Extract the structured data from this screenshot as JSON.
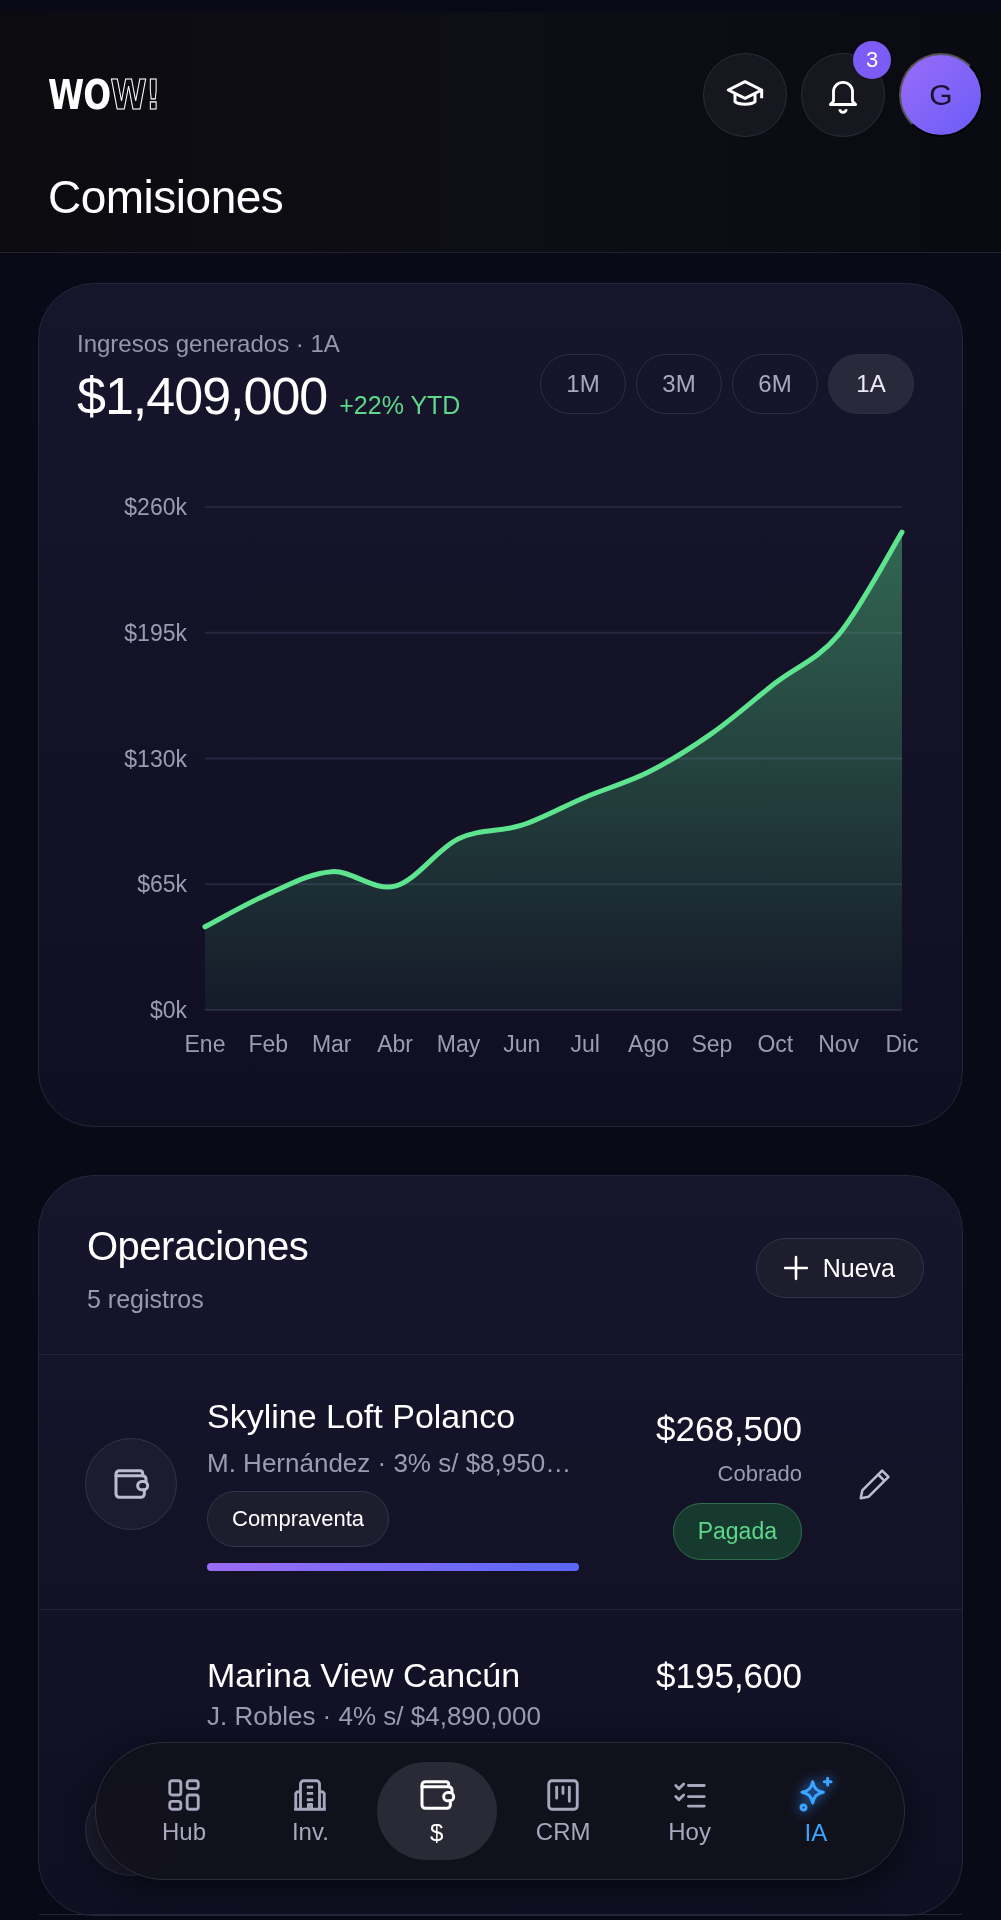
{
  "header": {
    "logo": "**WO**W!",
    "notifications": "3",
    "avatar": "G",
    "title": "Comisiones"
  },
  "revenue": {
    "label": "Ingresos generados · 1A",
    "amount": "$1,409,000",
    "change": "+22% YTD",
    "periods": [
      {
        "label": "1M",
        "selected": false
      },
      {
        "label": "3M",
        "selected": false
      },
      {
        "label": "6M",
        "selected": false
      },
      {
        "label": "1A",
        "selected": true
      }
    ],
    "chart_data": {
      "type": "area",
      "categories": [
        "Ene",
        "Feb",
        "Mar",
        "Abr",
        "May",
        "Jun",
        "Jul",
        "Ago",
        "Sep",
        "Oct",
        "Nov",
        "Dic"
      ],
      "grid": true,
      "series": [
        {
          "color": "#5ee38f",
          "values": [
            43000,
            60000,
            71500,
            64000,
            88500,
            95500,
            110000,
            123000,
            143000,
            169000,
            194000,
            247000
          ]
        }
      ],
      "ylim": [
        0,
        260000
      ],
      "yticks": [
        {
          "value": 0,
          "label": "$0k"
        },
        {
          "value": 65000,
          "label": "$65k"
        },
        {
          "value": 130000,
          "label": "$130k"
        },
        {
          "value": 195000,
          "label": "$195k"
        },
        {
          "value": 260000,
          "label": "$260k"
        }
      ]
    }
  },
  "operations": {
    "title": "Operaciones",
    "count": "5 registros",
    "new_button": "Nueva",
    "rows": [
      {
        "title": "Skyline Loft Polanco",
        "detail": "M. Hernández · 3% s/ $8,950…",
        "amount": "$268,500",
        "amount_label": "Cobrado",
        "tag": "Compraventa",
        "level": 1,
        "status": {
          "label": "Pagada",
          "kind": "paid"
        }
      },
      {
        "title": "Marina View Cancún",
        "detail": "J. Robles · 4% s/ $4,890,000",
        "amount": "$195,600"
      }
    ]
  },
  "nav": [
    {
      "label": "Hub",
      "kind": "grid",
      "selected": false,
      "accent": false
    },
    {
      "label": "Inv.",
      "kind": "building",
      "selected": false,
      "accent": false
    },
    {
      "label": "$",
      "kind": "wallet",
      "selected": true,
      "accent": false
    },
    {
      "label": "CRM",
      "kind": "board",
      "selected": false,
      "accent": false
    },
    {
      "label": "Hoy",
      "kind": "checklist",
      "selected": false,
      "accent": false
    },
    {
      "label": "IA",
      "kind": "sparkle",
      "selected": false,
      "accent": true
    }
  ]
}
